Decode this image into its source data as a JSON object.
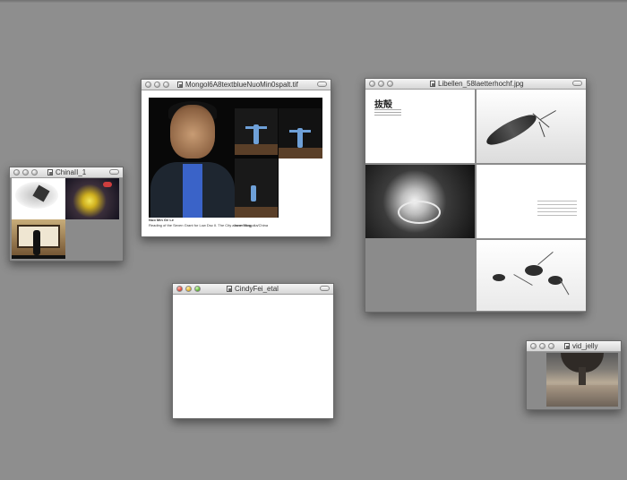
{
  "desktop": {
    "background": "#8e8e8e"
  },
  "windows": {
    "chinaii": {
      "title": "ChinaII_1",
      "active": false
    },
    "mongol": {
      "title": "Mongol6A8textblueNuoMin0spalt.tif",
      "active": false,
      "caption_name": "Nuo Min Ge Le",
      "caption_text": "Reading of the Seven Grant for Low Dsc II. The City above Mongolia/China",
      "caption_meta": "Inner Mog"
    },
    "libellen": {
      "title": "Libellen_58laetterhochf.jpg",
      "active": false,
      "heading": "抜殻"
    },
    "cindyfei": {
      "title": "CindyFei_etal",
      "active": true
    },
    "vidjelly": {
      "title": "vid_jelly",
      "active": false
    }
  },
  "icons": [
    "document-icon",
    "close-light",
    "minimize-light",
    "zoom-light",
    "toolbar-toggle"
  ]
}
